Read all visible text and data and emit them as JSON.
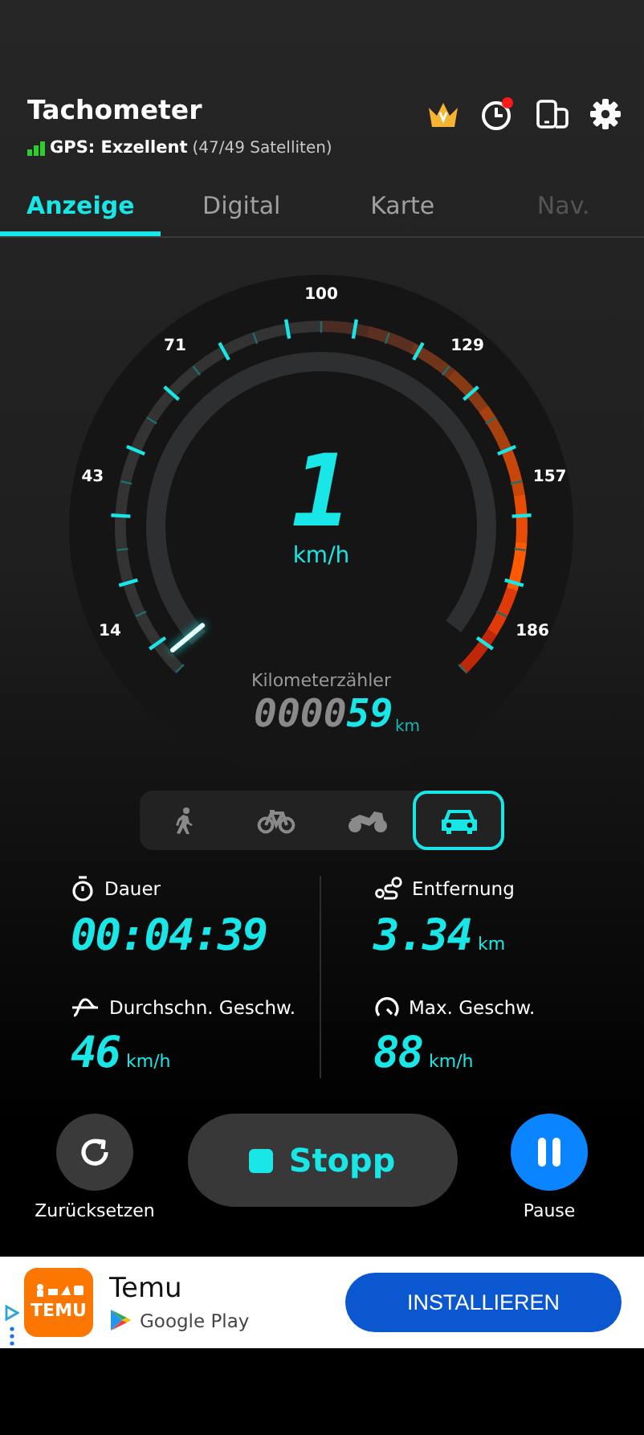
{
  "header": {
    "title": "Tachometer",
    "gps_label": "GPS: Exzellent",
    "gps_satellites": "(47/49 Satelliten)",
    "notification": true
  },
  "tabs": [
    {
      "label": "Anzeige",
      "selected": true,
      "disabled": false
    },
    {
      "label": "Digital",
      "selected": false,
      "disabled": false
    },
    {
      "label": "Karte",
      "selected": false,
      "disabled": false
    },
    {
      "label": "Nav.",
      "selected": false,
      "disabled": true
    }
  ],
  "gauge": {
    "scale_labels": [
      "14",
      "43",
      "71",
      "100",
      "129",
      "157",
      "186"
    ],
    "speed": "1",
    "unit": "km/h",
    "odometer_label": "Kilometerzähler",
    "odometer_dim": "0000",
    "odometer_value": "59",
    "odometer_unit": "km"
  },
  "modes": [
    {
      "kind": "walk",
      "selected": false
    },
    {
      "kind": "bicycle",
      "selected": false
    },
    {
      "kind": "motorcycle",
      "selected": false
    },
    {
      "kind": "car",
      "selected": true
    }
  ],
  "stats": [
    {
      "kind": "duration",
      "label": "Dauer",
      "value": "00:04:39"
    },
    {
      "kind": "distance",
      "label": "Entfernung",
      "value": "3.34",
      "unit": "km"
    },
    {
      "kind": "average",
      "label": "Durchschn. Geschw.",
      "value": "46",
      "unit": "km/h"
    },
    {
      "kind": "max",
      "label": "Max. Geschw.",
      "value": "88",
      "unit": "km/h"
    }
  ],
  "controls": {
    "reset_label": "Zurücksetzen",
    "stop_label": "Stopp",
    "pause_label": "Pause"
  },
  "ad": {
    "logo_text": "TEMU",
    "app_name": "Temu",
    "store": "Google Play",
    "button": "INSTALLIEREN"
  }
}
